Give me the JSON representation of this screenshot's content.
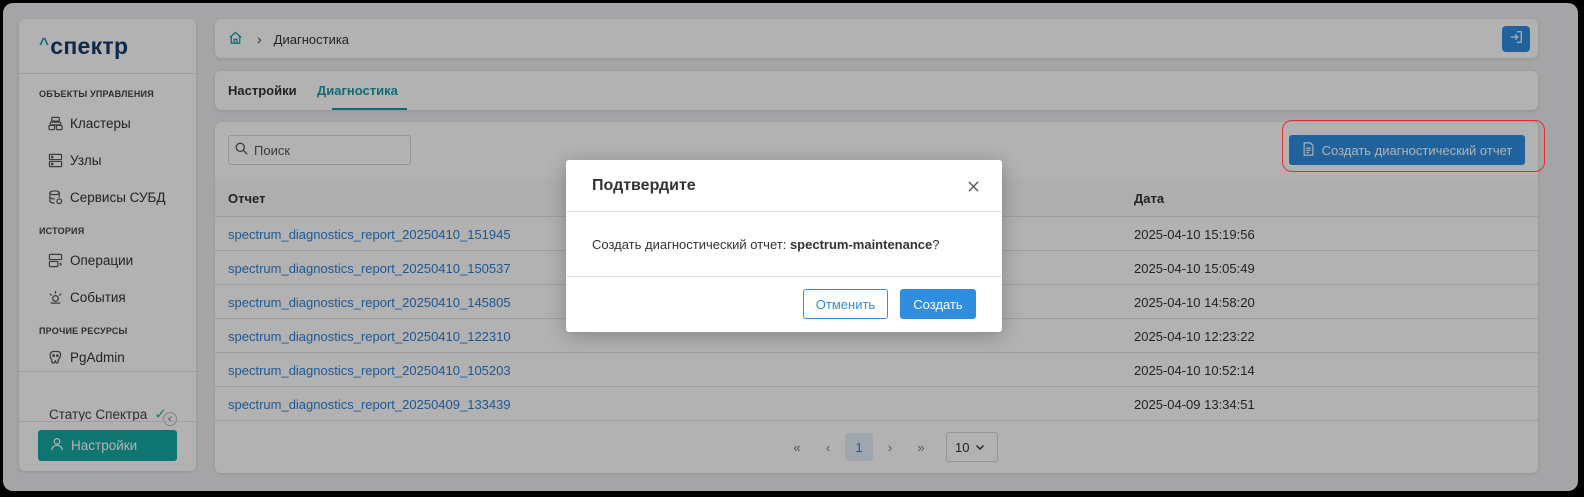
{
  "app": {
    "logo_text": "спектр"
  },
  "sidebar": {
    "sections": [
      {
        "label": "ОБЪЕКТЫ УПРАВЛЕНИЯ",
        "items": [
          {
            "label": "Кластеры",
            "icon": "cluster-icon"
          },
          {
            "label": "Узлы",
            "icon": "server-icon"
          },
          {
            "label": "Сервисы СУБД",
            "icon": "database-icon"
          }
        ]
      },
      {
        "label": "ИСТОРИЯ",
        "items": [
          {
            "label": "Операции",
            "icon": "operations-icon"
          },
          {
            "label": "События",
            "icon": "events-icon"
          }
        ]
      },
      {
        "label": "ПРОЧИЕ РЕСУРСЫ",
        "items": [
          {
            "label": "PgAdmin",
            "icon": "pgadmin-icon"
          }
        ]
      }
    ],
    "status_label": "Статус Спектра",
    "settings_label": "Настройки"
  },
  "topbar": {
    "breadcrumb": "Диагностика"
  },
  "tabs": [
    {
      "label": "Настройки",
      "active": false
    },
    {
      "label": "Диагностика",
      "active": true
    }
  ],
  "toolbar": {
    "search_placeholder": "Поиск",
    "create_report_label": "Создать диагностический отчет"
  },
  "table": {
    "columns": [
      "Отчет",
      "Дата"
    ],
    "rows": [
      {
        "report": "spectrum_diagnostics_report_20250410_151945",
        "date": "2025-04-10 15:19:56"
      },
      {
        "report": "spectrum_diagnostics_report_20250410_150537",
        "date": "2025-04-10 15:05:49"
      },
      {
        "report": "spectrum_diagnostics_report_20250410_145805",
        "date": "2025-04-10 14:58:20"
      },
      {
        "report": "spectrum_diagnostics_report_20250410_122310",
        "date": "2025-04-10 12:23:22"
      },
      {
        "report": "spectrum_diagnostics_report_20250410_105203",
        "date": "2025-04-10 10:52:14"
      },
      {
        "report": "spectrum_diagnostics_report_20250409_133439",
        "date": "2025-04-09 13:34:51"
      }
    ]
  },
  "pagination": {
    "first": "«",
    "prev": "‹",
    "current_page": "1",
    "next": "›",
    "last": "»",
    "page_size": "10"
  },
  "modal": {
    "title": "Подтвердите",
    "message_prefix": "Создать диагностический отчет: ",
    "message_bold": "spectrum-maintenance",
    "message_suffix": "?",
    "cancel_label": "Отменить",
    "confirm_label": "Создать"
  },
  "colors": {
    "accent_teal": "#16a8a3",
    "primary_blue": "#2f8ee0",
    "highlight_red": "#e03030"
  }
}
